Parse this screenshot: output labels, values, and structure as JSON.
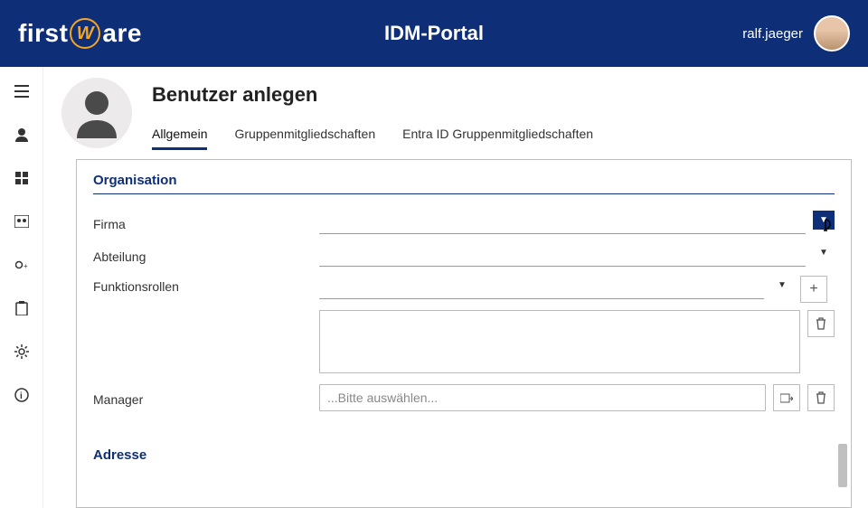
{
  "header": {
    "brand_first": "first",
    "brand_last": "are",
    "brand_w": "W",
    "title": "IDM-Portal",
    "username": "ralf.jaeger"
  },
  "page_title": "Benutzer anlegen",
  "tabs": [
    {
      "label": "Allgemein",
      "active": true
    },
    {
      "label": "Gruppenmitgliedschaften"
    },
    {
      "label": "Entra ID Gruppenmitgliedschaften"
    }
  ],
  "sections": {
    "organisation": {
      "heading": "Organisation",
      "firma_label": "Firma",
      "abteilung_label": "Abteilung",
      "funktionsrollen_label": "Funktionsrollen",
      "manager_label": "Manager",
      "manager_placeholder": "...Bitte auswählen..."
    },
    "adresse": {
      "heading": "Adresse"
    }
  }
}
